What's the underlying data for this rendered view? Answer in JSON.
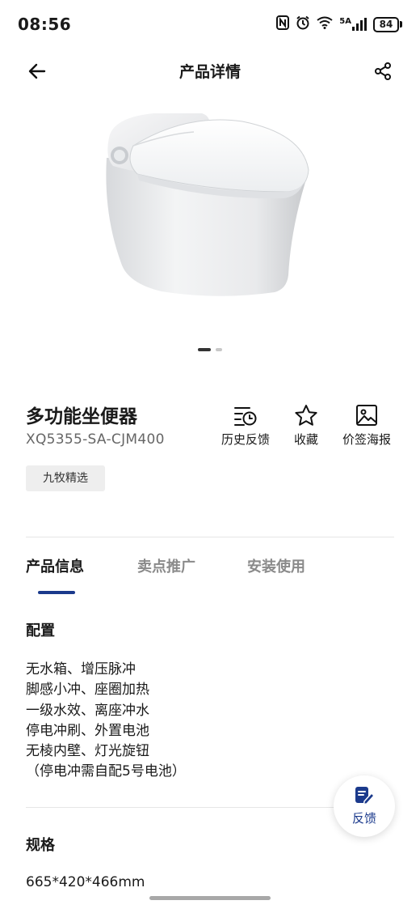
{
  "status_bar": {
    "time": "08:56",
    "network": "5A",
    "battery": "84"
  },
  "nav": {
    "title": "产品详情"
  },
  "carousel": {
    "total": 2,
    "current": 1
  },
  "product": {
    "name": "多功能坐便器",
    "code": "XQ5355-SA-CJM400",
    "brand_tag": "九牧精选"
  },
  "actions": {
    "history_label": "历史反馈",
    "favorite_label": "收藏",
    "poster_label": "价签海报"
  },
  "tabs": [
    {
      "label": "产品信息",
      "active": true
    },
    {
      "label": "卖点推广",
      "active": false
    },
    {
      "label": "安装使用",
      "active": false
    }
  ],
  "config": {
    "title": "配置",
    "lines": [
      "无水箱、增压脉冲",
      "脚感小冲、座圈加热",
      "一级水效、离座冲水",
      "停电冲刷、外置电池",
      "无棱内壁、灯光旋钮",
      "（停电冲需自配5号电池）"
    ]
  },
  "spec": {
    "title": "规格",
    "value": "665*420*466mm"
  },
  "feedback": {
    "label": "反馈"
  },
  "colors": {
    "accent": "#1b3a8c"
  }
}
